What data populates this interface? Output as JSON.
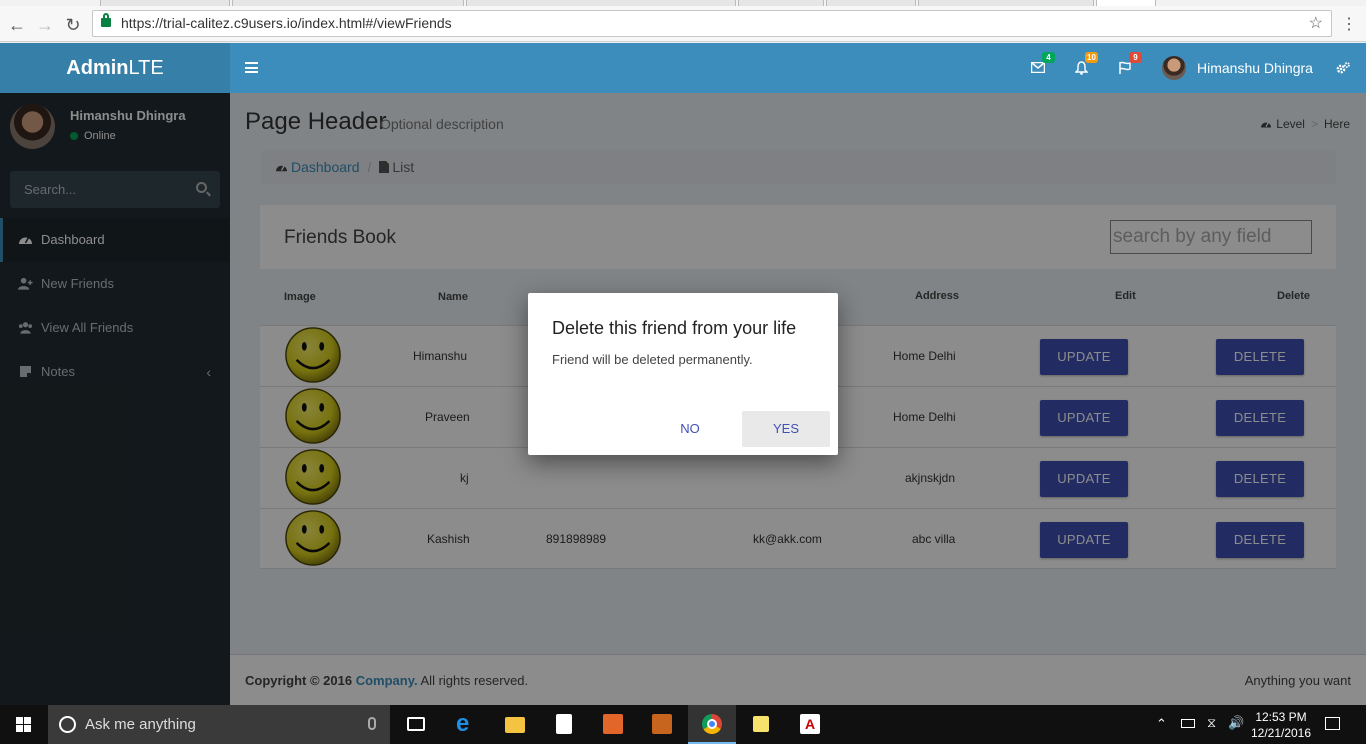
{
  "browser": {
    "url": "https://trial-calitez.c9users.io/index.html#/viewFriends"
  },
  "header": {
    "logo_bold": "Admin",
    "logo_rest": "LTE",
    "messages_count": "4",
    "notifications_count": "10",
    "tasks_count": "9",
    "user_name": "Himanshu Dhingra",
    "colors": {
      "primary": "#3c8dbc",
      "logo_bg": "#367fa9",
      "green_badge": "#00a65a",
      "orange_badge": "#f39c12",
      "red_badge": "#dd4b39"
    }
  },
  "sidebar": {
    "user_name": "Himanshu Dhingra",
    "status": "Online",
    "search_placeholder": "Search...",
    "items": [
      {
        "label": "Dashboard",
        "icon": "dashboard-icon"
      },
      {
        "label": "New Friends",
        "icon": "user-plus-icon"
      },
      {
        "label": "View All Friends",
        "icon": "users-icon"
      },
      {
        "label": "Notes",
        "icon": "notes-icon"
      }
    ]
  },
  "page": {
    "title": "Page Header",
    "description": "Optional description",
    "crumb_level": "Level",
    "crumb_here": "Here",
    "crumb_dashboard": "Dashboard",
    "crumb_list": "List"
  },
  "friends_book": {
    "title": "Friends Book",
    "search_placeholder": "search by any field",
    "columns": {
      "image": "Image",
      "name": "Name",
      "address": "Address",
      "edit": "Edit",
      "delete": "Delete"
    },
    "rows": [
      {
        "name": "Himanshu",
        "phone": "",
        "email": "",
        "address": "Home Delhi"
      },
      {
        "name": "Praveen",
        "phone": "",
        "email": "",
        "address": "Home Delhi"
      },
      {
        "name": "kj",
        "phone": "",
        "email": "",
        "address": "akjnskjdn"
      },
      {
        "name": "Kashish",
        "phone": "891898989",
        "email": "kk@akk.com",
        "address": "abc villa"
      }
    ],
    "update_label": "UPDATE",
    "delete_label": "DELETE"
  },
  "dialog": {
    "title": "Delete this friend from your life",
    "message": "Friend will be deleted permanently.",
    "no_label": "NO",
    "yes_label": "YES"
  },
  "footer": {
    "copyright_prefix": "Copyright © 2016 ",
    "company": "Company.",
    "suffix": " All rights reserved.",
    "right_text": "Anything you want"
  },
  "taskbar": {
    "search_placeholder": "Ask me anything",
    "time": "12:53 PM",
    "date": "12/21/2016"
  }
}
